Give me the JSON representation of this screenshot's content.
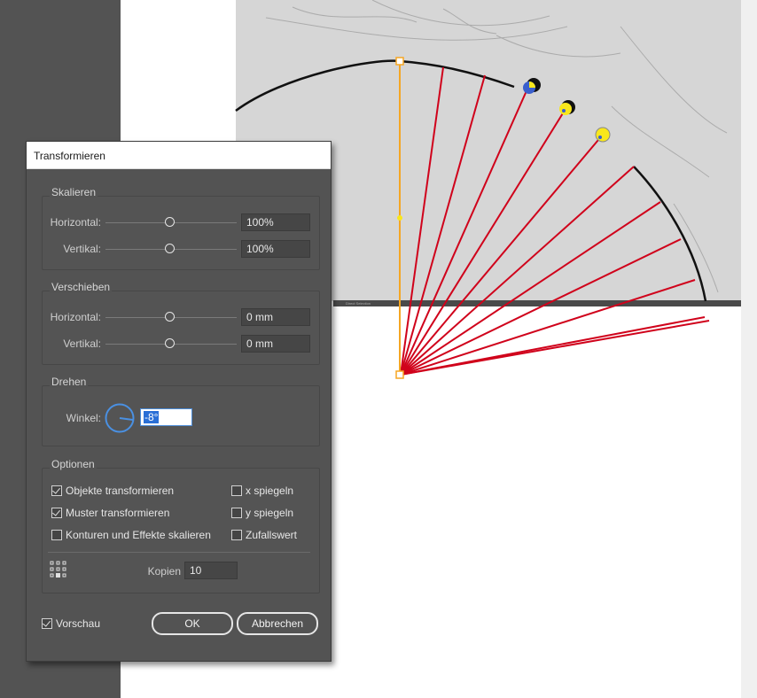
{
  "dialog": {
    "title": "Transformieren",
    "scale": {
      "title": "Skalieren",
      "horizontal_label": "Horizontal:",
      "horizontal_value": "100%",
      "vertical_label": "Vertikal:",
      "vertical_value": "100%"
    },
    "move": {
      "title": "Verschieben",
      "horizontal_label": "Horizontal:",
      "horizontal_value": "0 mm",
      "vertical_label": "Vertikal:",
      "vertical_value": "0 mm"
    },
    "rotate": {
      "title": "Drehen",
      "angle_label": "Winkel:",
      "angle_value": "-8°"
    },
    "options": {
      "title": "Optionen",
      "transform_objects": {
        "label": "Objekte transformieren",
        "checked": true
      },
      "transform_patterns": {
        "label": "Muster transformieren",
        "checked": true
      },
      "scale_strokes_effects": {
        "label": "Konturen und Effekte skalieren",
        "checked": false
      },
      "reflect_x": {
        "label": "x spiegeln",
        "checked": false
      },
      "reflect_y": {
        "label": "y spiegeln",
        "checked": false
      },
      "random": {
        "label": "Zufallswert",
        "checked": false
      },
      "copies_label": "Kopien",
      "copies_value": "10"
    },
    "preview": {
      "label": "Vorschau",
      "checked": true
    },
    "ok_label": "OK",
    "cancel_label": "Abbrechen"
  },
  "canvas": {
    "sketch_strip_text": "Direct Selection",
    "line_color": "#d0021b",
    "selection_color": "#f5a623",
    "accent_color": "#4a90e2"
  }
}
